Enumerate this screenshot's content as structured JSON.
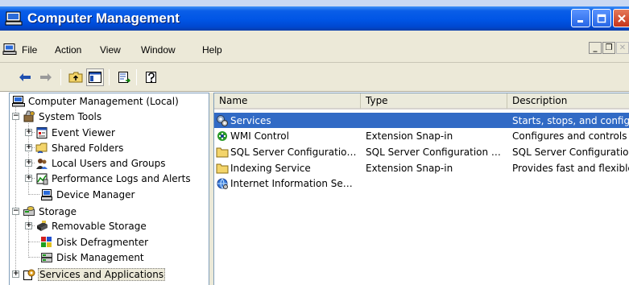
{
  "window": {
    "title": "Computer Management"
  },
  "menu": {
    "file": "File",
    "action": "Action",
    "view": "View",
    "window": "Window",
    "help": "Help"
  },
  "tree": {
    "root": "Computer Management (Local)",
    "system_tools": "System Tools",
    "event_viewer": "Event Viewer",
    "shared_folders": "Shared Folders",
    "local_users": "Local Users and Groups",
    "perf_logs": "Performance Logs and Alerts",
    "device_manager": "Device Manager",
    "storage": "Storage",
    "removable_storage": "Removable Storage",
    "disk_defrag": "Disk Defragmenter",
    "disk_mgmt": "Disk Management",
    "services_apps": "Services and Applications"
  },
  "list": {
    "columns": [
      "Name",
      "Type",
      "Description"
    ],
    "rows": [
      {
        "name": "Services",
        "type": "",
        "description": "Starts, stops, and configures Windows services.",
        "icon": "services-icon"
      },
      {
        "name": "WMI Control",
        "type": "Extension Snap-in",
        "description": "Configures and controls the Windows Management Instrumentation service.",
        "icon": "wmi-icon"
      },
      {
        "name": "SQL Server Configuratio…",
        "type": "SQL Server Configuration …",
        "description": "SQL Server Configuration Manager",
        "icon": "folder-icon"
      },
      {
        "name": "Indexing Service",
        "type": "Extension Snap-in",
        "description": "Provides fast and flexible searching.",
        "icon": "folder-icon"
      },
      {
        "name": "Internet Information Se…",
        "type": "",
        "description": "",
        "icon": "iis-icon"
      }
    ]
  },
  "colors": {
    "titlebar": "#0055e5",
    "selection": "#316ac5",
    "chrome": "#ece9d8"
  }
}
